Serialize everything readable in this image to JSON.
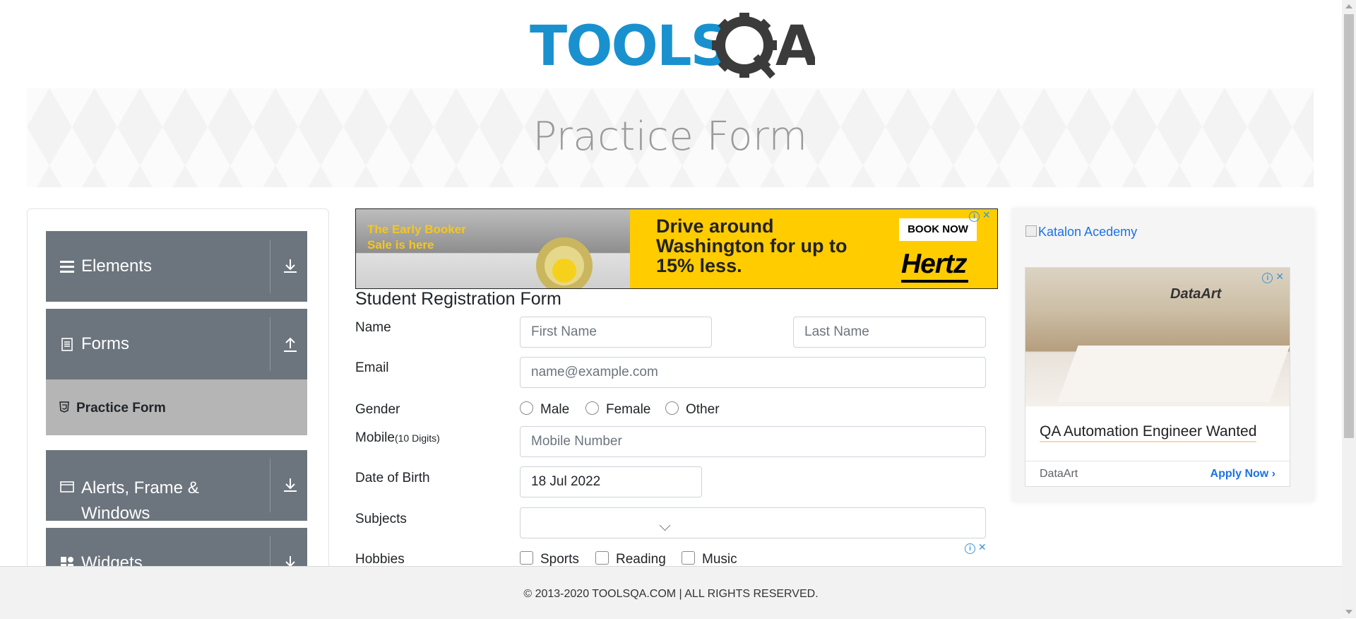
{
  "header": {
    "logo_text": "TOOLSQA",
    "page_title": "Practice Form"
  },
  "sidebar": {
    "groups": [
      {
        "label": "Elements",
        "icon": "hamburger-icon",
        "arrow": "download-arrow-icon"
      },
      {
        "label": "Forms",
        "icon": "document-icon",
        "arrow": "upload-arrow-icon"
      },
      {
        "label": "Alerts, Frame & Windows",
        "icon": "window-icon",
        "arrow": "download-arrow-icon"
      },
      {
        "label": "Widgets",
        "icon": "widget-icon",
        "arrow": "download-arrow-icon"
      }
    ],
    "active_item": {
      "label": "Practice Form",
      "icon": "html5-icon"
    }
  },
  "ad_top": {
    "tagline": "The Early Booker Sale is here",
    "headline": "Drive around Washington for up to 15% less.",
    "cta": "BOOK NOW",
    "brand": "Hertz"
  },
  "form": {
    "title": "Student Registration Form",
    "name_label": "Name",
    "first_name_placeholder": "First Name",
    "last_name_placeholder": "Last Name",
    "email_label": "Email",
    "email_placeholder": "name@example.com",
    "gender_label": "Gender",
    "gender_options": [
      "Male",
      "Female",
      "Other"
    ],
    "mobile_label": "Mobile",
    "mobile_hint": "(10 Digits)",
    "mobile_placeholder": "Mobile Number",
    "dob_label": "Date of Birth",
    "dob_value": "18 Jul 2022",
    "subjects_label": "Subjects",
    "hobbies_label": "Hobbies",
    "hobbies_options": [
      "Sports",
      "Reading",
      "Music"
    ]
  },
  "ad_right": {
    "image_alt": "Katalon Acedemy",
    "card_title": "QA Automation Engineer Wanted",
    "advertiser": "DataArt",
    "cta": "Apply Now",
    "image_logo": "DataArt"
  },
  "footer": {
    "text": "© 2013-2020 TOOLSQA.COM | ALL RIGHTS RESERVED."
  },
  "colors": {
    "sidebar_group": "#6c757d",
    "active_item": "#b5b5b5",
    "accent_blue": "#1a73e8",
    "ad_yellow": "#ffcc00"
  }
}
